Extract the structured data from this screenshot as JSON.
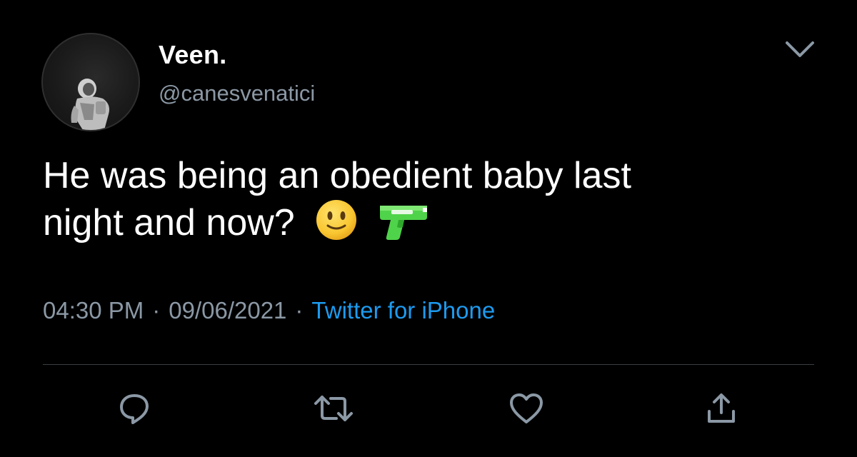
{
  "tweet": {
    "author": {
      "display_name": "Veen.",
      "handle": "@canesvenatici",
      "avatar_icon": "astronaut-avatar"
    },
    "text_lines": [
      "He was being an obedient baby last",
      "night and now?"
    ],
    "emojis": [
      "slightly-smiling-face-emoji",
      "water-pistol-emoji"
    ],
    "meta": {
      "time": "04:30 PM",
      "separator": "·",
      "date": "09/06/2021",
      "source": "Twitter for iPhone"
    },
    "menu_icon": "chevron-down-icon",
    "actions": [
      {
        "name": "reply",
        "icon": "reply-icon"
      },
      {
        "name": "retweet",
        "icon": "retweet-icon"
      },
      {
        "name": "like",
        "icon": "heart-icon"
      },
      {
        "name": "share",
        "icon": "share-icon"
      }
    ]
  },
  "colors": {
    "background": "#000000",
    "text_primary": "#ffffff",
    "text_secondary": "#8b98a5",
    "link": "#1d9bf0",
    "divider": "#3a3f44",
    "icon": "#8b98a5"
  }
}
